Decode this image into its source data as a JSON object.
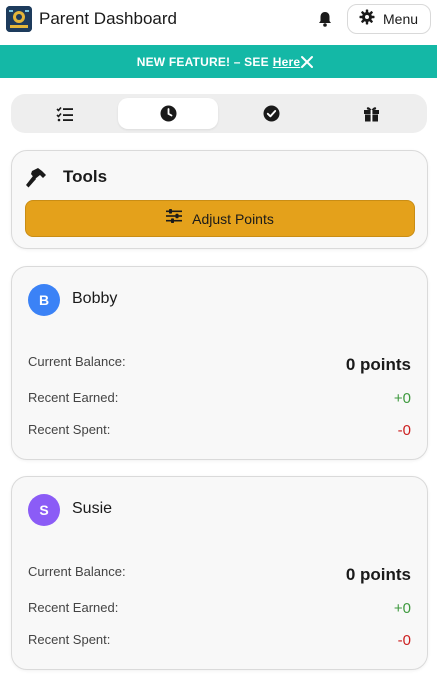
{
  "header": {
    "title": "Parent Dashboard",
    "menu_label": "Menu",
    "logo_icon": "app-logo",
    "bell_icon": "bell-icon",
    "menu_icon": "gear-icon"
  },
  "banner": {
    "text": "NEW FEATURE! – SEE",
    "link": "Here",
    "background": "#14b8a6"
  },
  "tabs": [
    {
      "icon": "checklist-icon",
      "active": false
    },
    {
      "icon": "clock-icon",
      "active": true
    },
    {
      "icon": "check-circle-icon",
      "active": false
    },
    {
      "icon": "gift-icon",
      "active": false
    }
  ],
  "tools": {
    "title": "Tools",
    "icon": "hammer-icon",
    "adjust_button": "Adjust Points",
    "adjust_icon": "sliders-icon",
    "accent": "#e4a11b"
  },
  "children": [
    {
      "initial": "B",
      "name": "Bobby",
      "avatar_color": "#3b82f6",
      "balance_label": "Current Balance:",
      "balance": "0 points",
      "earned_label": "Recent Earned:",
      "earned": "+0",
      "spent_label": "Recent Spent:",
      "spent": "-0"
    },
    {
      "initial": "S",
      "name": "Susie",
      "avatar_color": "#8b5cf6",
      "balance_label": "Current Balance:",
      "balance": "0 points",
      "earned_label": "Recent Earned:",
      "earned": "+0",
      "spent_label": "Recent Spent:",
      "spent": "-0"
    }
  ]
}
